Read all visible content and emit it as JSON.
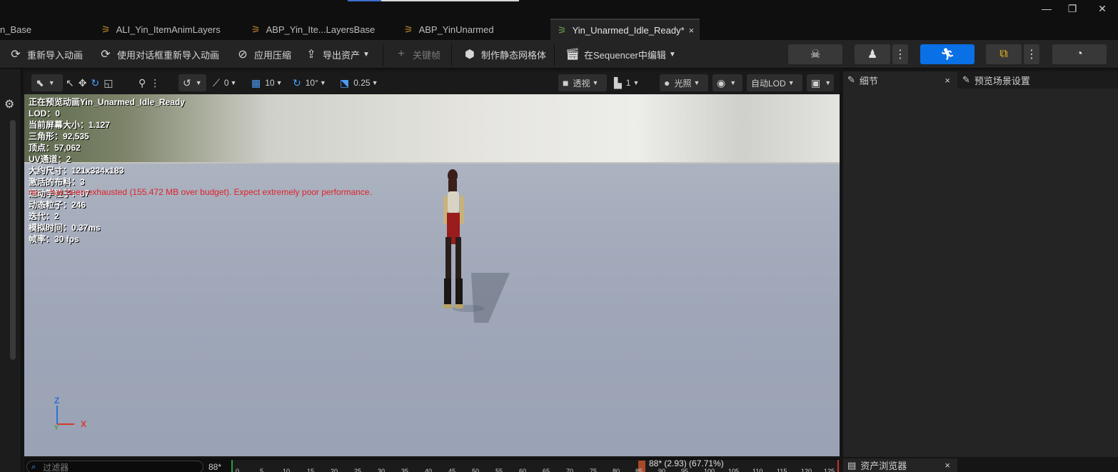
{
  "tabs": [
    {
      "label": "n_Base",
      "active": false
    },
    {
      "label": "ALI_Yin_ItemAnimLayers",
      "active": false
    },
    {
      "label": "ABP_Yin_Ite...LayersBase",
      "active": false
    },
    {
      "label": "ABP_YinUnarmed",
      "active": false
    },
    {
      "label": "Yin_Unarmed_Idle_Ready*",
      "active": true,
      "close": "×"
    }
  ],
  "window_controls": {
    "minimize": "—",
    "restore": "❐",
    "close": "✕"
  },
  "toolbar": {
    "reimport": "重新导入动画",
    "reimport_dialog": "使用对话框重新导入动画",
    "apply_compression": "应用压缩",
    "export_asset": "导出资产",
    "keyframe": "关键帧",
    "make_static_mesh": "制作静态网格体",
    "edit_in_sequencer": "在Sequencer中编辑"
  },
  "viewport_toolbar": {
    "rotation_snap_value": "0",
    "grid_snap": "10",
    "angle_snap": "10°",
    "scale_snap": "0.25",
    "perspective": "透视",
    "camera_speed": "1",
    "lighting": "光照",
    "lod": "自动LOD"
  },
  "stats": [
    "正在预览动画Yin_Unarmed_Idle_Ready",
    "LOD：0",
    "当前屏幕大小：1.127",
    "三角形：92,535",
    "顶点：57,062",
    "UV通道：2",
    "大约尺寸：121x334x183",
    "激活的布料：3",
    "运动学粒子：87",
    "动态粒子：246",
    "迭代：2",
    "模拟时间：0.37ms",
    "帧率：30 fps"
  ],
  "warning": "no ... has been exhausted (155.472 MB over budget). Expect extremely poor performance.",
  "axis": {
    "z": "Z",
    "x": "X",
    "y": "Y"
  },
  "right_panel": {
    "details_tab": "细节",
    "details_close": "×",
    "preview_scene_tab": "预览场景设置",
    "asset_browser_tab": "资产浏览器",
    "asset_browser_close": "×"
  },
  "bottom": {
    "filter_placeholder": "过滤器",
    "frame_count": "88*",
    "frame_info": "88* (2.93) (67.71%)",
    "ticks": [
      "0",
      "5",
      "10",
      "15",
      "20",
      "25",
      "30",
      "35",
      "40",
      "45",
      "50",
      "55",
      "60",
      "65",
      "70",
      "75",
      "80",
      "85",
      "90",
      "95",
      "100",
      "105",
      "110",
      "115",
      "120",
      "125"
    ]
  },
  "colors": {
    "accent_blue": "#0a70e6",
    "warning_red": "#e0222a",
    "play_green": "#6aa84f"
  }
}
